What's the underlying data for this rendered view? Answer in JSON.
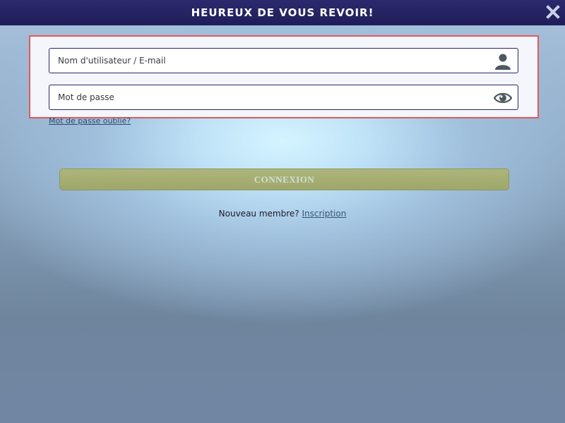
{
  "header": {
    "title": "HEUREUX DE VOUS REVOIR!"
  },
  "form": {
    "username_placeholder": "Nom d'utilisateur / E-mail",
    "username_value": "",
    "password_placeholder": "Mot de passe",
    "password_value": "",
    "forgot_label": "Mot de passe oublié?",
    "submit_label": "CONNEXION"
  },
  "signup": {
    "prompt": "Nouveau membre?",
    "link_label": "Inscription"
  },
  "icons": {
    "close": "close-icon",
    "user": "user-icon",
    "eye": "eye-icon"
  },
  "colors": {
    "header_bg": "#201e5a",
    "highlight_border": "#e05a5a",
    "field_border": "#2a2866",
    "button_bg": "#a4ad70"
  }
}
